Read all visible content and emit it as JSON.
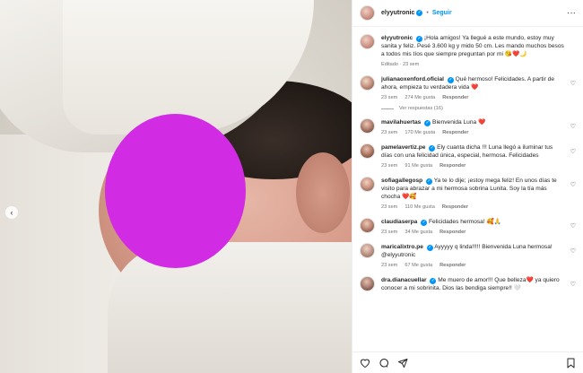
{
  "post": {
    "username": "elyyutronic",
    "follow_label": "Seguir",
    "separator": "•",
    "more": "···",
    "caption": "¡Hola amigos! Ya llegué a este mundo, estoy muy sanita y feliz. Pesé 3.600 kg y mido 50 cm. Les mando muchos besos a todos mis tíos que siempre preguntan por mi 😘❤️🌙",
    "caption_meta": "Editado · 23 sem",
    "prev_arrow": "‹"
  },
  "comments": [
    {
      "user": "julianaoxenford.oficial",
      "text": "Qué hermoso! Felicidades. A partir de ahora, empieza tu verdadera vida ❤️",
      "time": "23 sem",
      "likes": "274 Me gusta",
      "reply": "Responder",
      "view_replies": "Ver respuestas (16)"
    },
    {
      "user": "mavilahuertas",
      "text": "Bienvenida Luna ❤️",
      "time": "23 sem",
      "likes": "170 Me gusta",
      "reply": "Responder"
    },
    {
      "user": "pamelavertiz.pe",
      "text": "Ely cuanta dicha !!! Luna llegó a iluminar tus días con una felicidad única, especial, hermosa. Felicidades",
      "time": "23 sem",
      "likes": "91 Me gusta",
      "reply": "Responder"
    },
    {
      "user": "sofiagallegosp",
      "text": "Ya te lo dije; ¡estoy mega feliz! En unos días te visito para abrazar a mi hermosa sobrina Lunita. Soy la tía más chocha ❤️🥰",
      "time": "23 sem",
      "likes": "110 Me gusta",
      "reply": "Responder"
    },
    {
      "user": "claudiaserpa",
      "text": "Felicidades hermosa! 🥰🙏",
      "time": "23 sem",
      "likes": "34 Me gusta",
      "reply": "Responder"
    },
    {
      "user": "maricalixtro.pe",
      "text": "Ayyyyy q linda!!!!! Bienvenida Luna hermosa! @elyyutronic",
      "time": "23 sem",
      "likes": "67 Me gusta",
      "reply": "Responder"
    },
    {
      "user": "dra.dianacuellar",
      "text": "Me muero de amor!!! Que belleza❤️ ya quiero conocer a mi sobrinita. Dios las bendiga siempre!! 🤍",
      "time": "",
      "likes": "",
      "reply": ""
    }
  ],
  "icons": {
    "heart": "heart-icon",
    "comment": "comment-icon",
    "share": "share-icon",
    "save": "bookmark-icon",
    "verified": "verified-badge-icon"
  },
  "colors": {
    "accent": "#0095f6",
    "blur": "#d12be4"
  }
}
